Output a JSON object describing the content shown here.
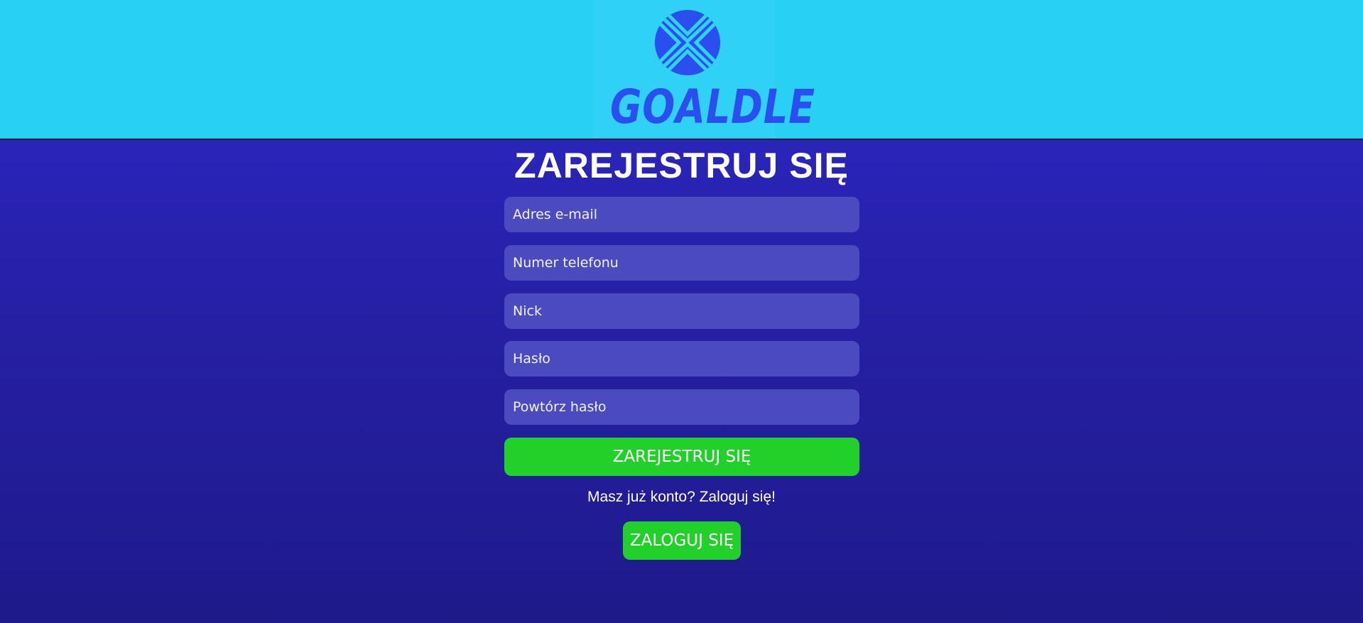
{
  "header": {
    "logo_text": "GOALDLE"
  },
  "form": {
    "title": "ZAREJESTRUJ SIĘ",
    "fields": {
      "email_placeholder": "Adres e-mail",
      "phone_placeholder": "Numer telefonu",
      "nick_placeholder": "Nick",
      "password_placeholder": "Hasło",
      "repeat_password_placeholder": "Powtórz hasło"
    },
    "register_label": "ZAREJESTRUJ SIĘ",
    "login_hint": "Masz już konto? Zaloguj się!",
    "login_label": "ZALOGUJ SIĘ"
  },
  "colors": {
    "header_bg": "#28d0f4",
    "page_bg_top": "#2d28cc",
    "page_bg_bottom": "#1e1a8a",
    "input_bg": "#4b4bbf",
    "button_bg": "#22d02a",
    "logo_blue": "#2a4ef0"
  }
}
